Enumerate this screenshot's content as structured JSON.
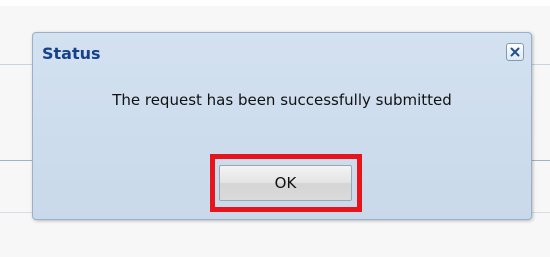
{
  "dialog": {
    "title": "Status",
    "message": "The request has been successfully submitted",
    "ok_label": "OK",
    "close_icon": "close-icon",
    "highlight_color": "#e8141b",
    "title_color": "#15428b"
  }
}
